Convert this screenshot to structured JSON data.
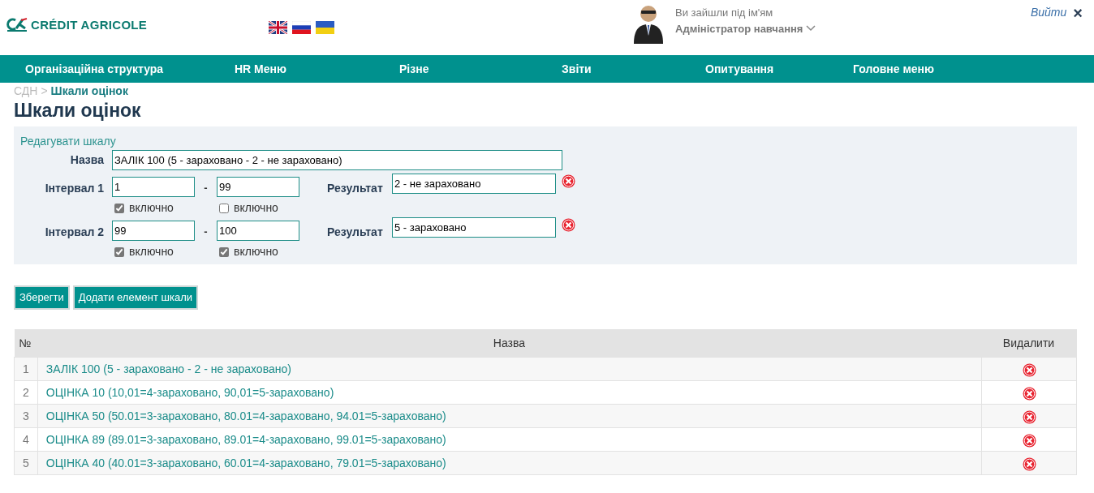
{
  "header": {
    "logo_text": "CRÉDIT AGRICOLE",
    "user_caption": "Ви зайшли під ім'ям",
    "user_name": "Адміністратор навчання",
    "logout": "Вийти",
    "close_symbol": "×"
  },
  "nav": [
    "Організаційна структура",
    "HR Меню",
    "Різне",
    "Звіти",
    "Опитування",
    "Головне меню"
  ],
  "breadcrumb": [
    {
      "label": "СДН",
      "current": false
    },
    {
      "label": "Шкали оцінок",
      "current": true
    }
  ],
  "breadcrumb_separator": ">",
  "page_title": "Шкали оцінок",
  "editor": {
    "legend": "Редагувати шкалу",
    "name_label": "Назва",
    "name_value": "ЗАЛІК 100 (5 - зараховано - 2 - не зараховано)",
    "intervals": [
      {
        "label": "Інтервал 1",
        "from": "1",
        "to": "99",
        "dash": "-",
        "from_inclusive": true,
        "to_inclusive": false,
        "from_check_label": "включно",
        "to_check_label": "включно",
        "result_label": "Результат",
        "result": "2 - не зараховано"
      },
      {
        "label": "Інтервал 2",
        "from": "99",
        "to": "100",
        "dash": "-",
        "from_inclusive": true,
        "to_inclusive": true,
        "from_check_label": "включно",
        "to_check_label": "включно",
        "result_label": "Результат",
        "result": "5 - зараховано"
      }
    ]
  },
  "buttons": [
    "Зберегти",
    "Додати елемент шкали"
  ],
  "table": {
    "columns": [
      "№",
      "Назва",
      "Видалити"
    ],
    "rows": [
      {
        "number": "1",
        "name": "ЗАЛІК 100 (5 - зараховано - 2 - не зараховано)"
      },
      {
        "number": "2",
        "name": "ОЦІНКА 10 (10,01=4-зараховано, 90,01=5-зараховано)"
      },
      {
        "number": "3",
        "name": "ОЦІНКА 50 (50.01=3-зараховано, 80.01=4-зараховано, 94.01=5-зараховано)"
      },
      {
        "number": "4",
        "name": "ОЦІНКА 89 (89.01=3-зараховано, 89.01=4-зараховано, 99.01=5-зараховано)"
      },
      {
        "number": "5",
        "name": "ОЦІНКА 40 (40.01=3-зараховано, 60.01=4-зараховано, 79.01=5-зараховано)"
      }
    ]
  }
}
